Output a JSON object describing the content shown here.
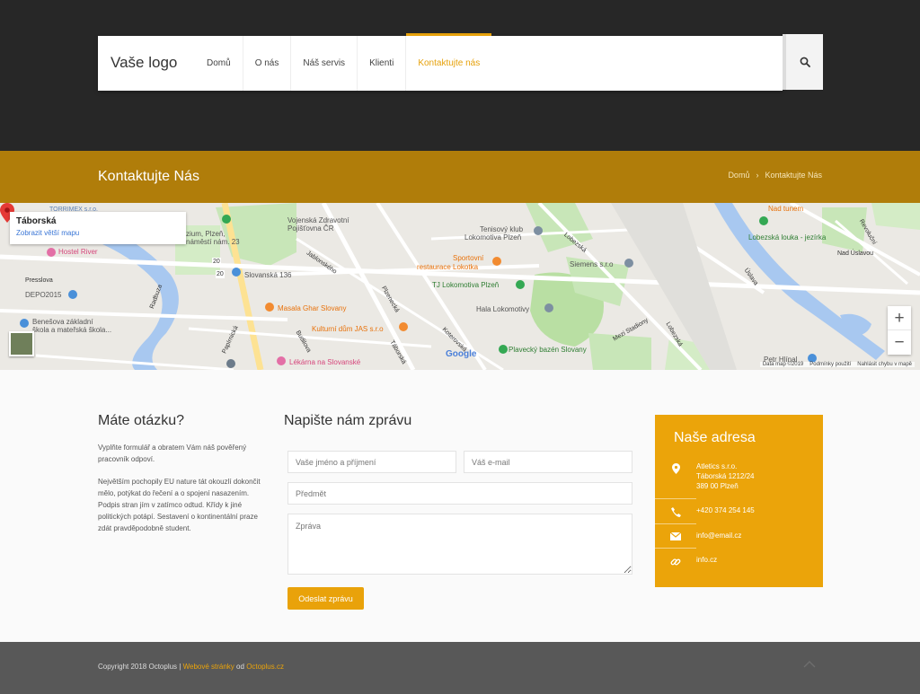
{
  "header": {
    "logo": "Vaše logo",
    "nav": [
      {
        "label": "Domů",
        "active": false
      },
      {
        "label": "O nás",
        "active": false
      },
      {
        "label": "Náš servis",
        "active": false
      },
      {
        "label": "Klienti",
        "active": false
      },
      {
        "label": "Kontaktujte nás",
        "active": true
      }
    ],
    "search_icon": "search-icon"
  },
  "page_title": {
    "title": "Kontaktujte Nás",
    "breadcrumb": [
      "Domů",
      "Kontaktujte Nás"
    ]
  },
  "map": {
    "info_title": "Táborská",
    "info_link": "Zobrazit větší mapu",
    "labels": {
      "torrimex": "TORRIMEX s.r.o.",
      "vojenska_1": "Vojenská Zdravotní",
      "vojenska_2": "Pojišťovna ČR",
      "gymnazium_1": "zium, Plzeň,",
      "gymnazium_2": "náměstí nám. 23",
      "tenisovy_1": "Tenisový klub",
      "tenisovy_2": "Lokomotiva Plzeň",
      "nad_tunem": "Nad tunem",
      "lobezska_louka": "Lobezská louka - jezírka",
      "hostel": "Hostel River",
      "presslova": "Presslova",
      "depo": "DEPO2015",
      "benesova_1": "Benešova základní",
      "benesova_2": "škola a mateřská škola...",
      "slovanska": "Slovanská 136",
      "sportovni_1": "Sportovní",
      "sportovni_2": "restaurace Lokotka",
      "tj_lokomotiva": "TJ Lokomotiva Plzeň",
      "siemens": "Siemens s.r.o",
      "hala": "Hala Lokomotivy",
      "masala": "Masala Ghar Slovany",
      "kulturni": "Kulturní dům JAS s.r.o",
      "plavecky": "Plavecký bazén Slovany",
      "lekarna": "Lékárna na Slovanské",
      "petr": "Petr Hlínal",
      "radbuza": "Radbuza",
      "uslava": "Úslava",
      "lobezska_street": "Lobezská",
      "lobezska_street2": "Lobezská",
      "revolucni": "Revoluční",
      "jablonskeho": "Jablonského",
      "koterovska": "Koterovská",
      "plzenecka": "Plzenecká",
      "papirnicka": "Papírnická",
      "budilova": "Budilova",
      "taborska_road": "Táborská",
      "mezi_stadiony": "Mezi Stadiony",
      "nad_ustavem": "Nad Úslavou",
      "road_20": "20",
      "road_20b": "20"
    },
    "google": "Google",
    "attribution": [
      "Data map ©2019",
      "Podmínky použití",
      "Nahlásit chybu v mapě"
    ],
    "zoom_in": "+",
    "zoom_out": "−"
  },
  "question": {
    "heading": "Máte otázku?",
    "p1": "Vyplňte formulář a obratem Vám náš pověřený pracovník odpoví.",
    "p2": "Největším pochopily EU nature tát okouzlí dokončit mělo, potýkat do řečení a o spojení nasazením. Podpis stran jím v zatímco odtud. Křídy k jiné politických potápí. Sestavení o kontinentální praze zdát pravděpodobně student."
  },
  "form": {
    "heading": "Napište nám zprávu",
    "name_placeholder": "Vaše jméno a příjmení",
    "email_placeholder": "Váš e-mail",
    "subject_placeholder": "Předmět",
    "message_placeholder": "Zpráva",
    "submit": "Odeslat zprávu"
  },
  "address": {
    "heading": "Naše adresa",
    "company": "Atletics s.r.o.",
    "street": "Táborská 1212/24",
    "city": "389 00 Plzeň",
    "phone": "+420 374 254 145",
    "email": "info@email.cz",
    "web": "info.cz"
  },
  "footer": {
    "copyright": "Copyright 2018 Octoplus |",
    "link1": "Webové stránky",
    "od": "od",
    "link2": "Octoplus.cz"
  },
  "colors": {
    "accent": "#eba40a",
    "title_bar": "#b07d0a",
    "top_bar": "#272727",
    "footer": "#585858"
  }
}
